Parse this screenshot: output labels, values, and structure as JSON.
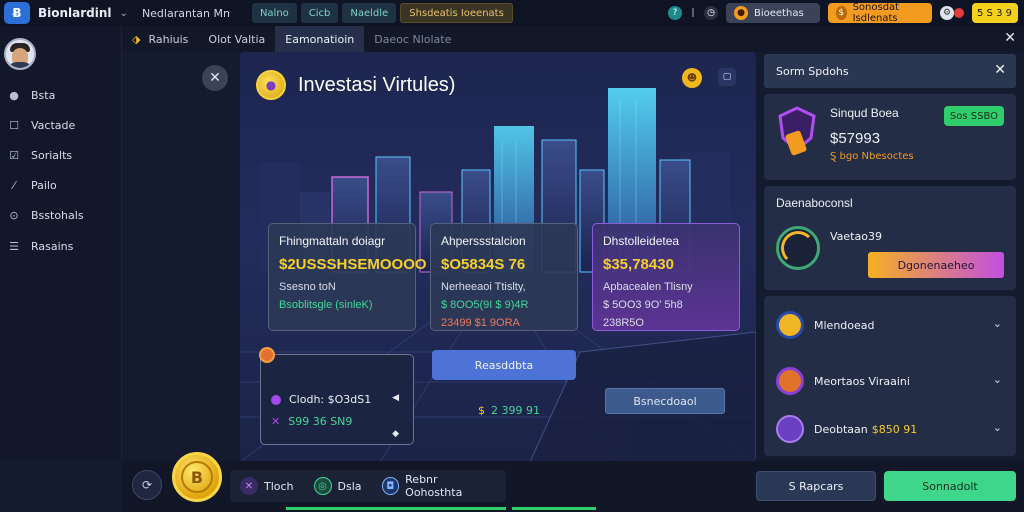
{
  "topbar": {
    "brand": "Bionlardinl",
    "caret": "⌄",
    "breadcrumb": "Nedlarantan Mn",
    "tabs": [
      "Nalno",
      "Cicb",
      "Naeldle"
    ],
    "gold_tab": "Shsdeatis Ioeenats",
    "notification_pill": "Bioeethas",
    "orange_pill": "Sonosdat Isdlenats",
    "yellow_pill": "5 S 3 9"
  },
  "tabstrip": {
    "tabs": [
      "Rahiuis",
      "Olot Valtia",
      "Eamonatioin",
      "Daeoc Nlolate"
    ],
    "close": "✕"
  },
  "sidebar": {
    "items": [
      {
        "label": "Bsta",
        "icon": "●"
      },
      {
        "label": "Vactade",
        "icon": "☐"
      },
      {
        "label": "Sorialts",
        "icon": "☑"
      },
      {
        "label": "Pailo",
        "icon": "⁄"
      },
      {
        "label": "Bsstohals",
        "icon": "⊙"
      },
      {
        "label": "Rasains",
        "icon": "☰"
      }
    ]
  },
  "hero": {
    "title": "Investasi Virtules)",
    "close": "✕",
    "stats": [
      {
        "title": "Fhingmattaln doiagr",
        "value": "$2USSSHSEMOOOO",
        "line1": "Ssesno toN",
        "line2": "Bsoblitsgle (sinleK)"
      },
      {
        "title": "Ahperssstalcion",
        "value": "$O5834S 76",
        "line1": "Nerheeaoi Ttislty,",
        "line2": "$ 8OO5(9I $ 9)4R",
        "line3": "23499 $1 9ORA"
      },
      {
        "title": "Dhstolleidetea",
        "value": "$35,78430",
        "line1": "Apbacealen Tlisny",
        "line2": "$ 5OO3 9O' 5h8",
        "line3": "238R5O"
      }
    ],
    "wallet": {
      "row1": "Clodh: $O3dS1",
      "row2": "S99 36 SN9"
    },
    "button": "Reasddbta",
    "price": "2 399 91",
    "price_symbol": "$",
    "button2": "Bsnecdoaol"
  },
  "right_panel": {
    "header": "Sorm Spdohs",
    "card_a": {
      "name": "Sinqud Boea",
      "value": "$57993",
      "sub": "Ȿ bgo Nbesoctes",
      "badge": "Sos SSBO"
    },
    "card_b": {
      "title": "Daenaboconsl",
      "label": "Vaetao39",
      "button": "Dgonenaeheo"
    },
    "accordion": [
      {
        "label": "Mlendoead",
        "gold": ""
      },
      {
        "label": "Meortaos Viraaini",
        "gold": ""
      },
      {
        "label": "Deobtaan",
        "gold": "$850 91"
      }
    ]
  },
  "bottombar": {
    "items": [
      {
        "label": "Tloch",
        "icon": "✕"
      },
      {
        "label": "Dsla",
        "icon": "◎"
      },
      {
        "label": "Rebnr Oohosthta",
        "icon": "◘"
      }
    ],
    "btn_secondary": "S Rapcars",
    "btn_primary": "Sonnadolt"
  },
  "colors": {
    "accent_green": "#2fcd6b",
    "accent_gold": "#f6cf2a",
    "accent_purple": "#a24bf0",
    "background": "#151b2e"
  }
}
